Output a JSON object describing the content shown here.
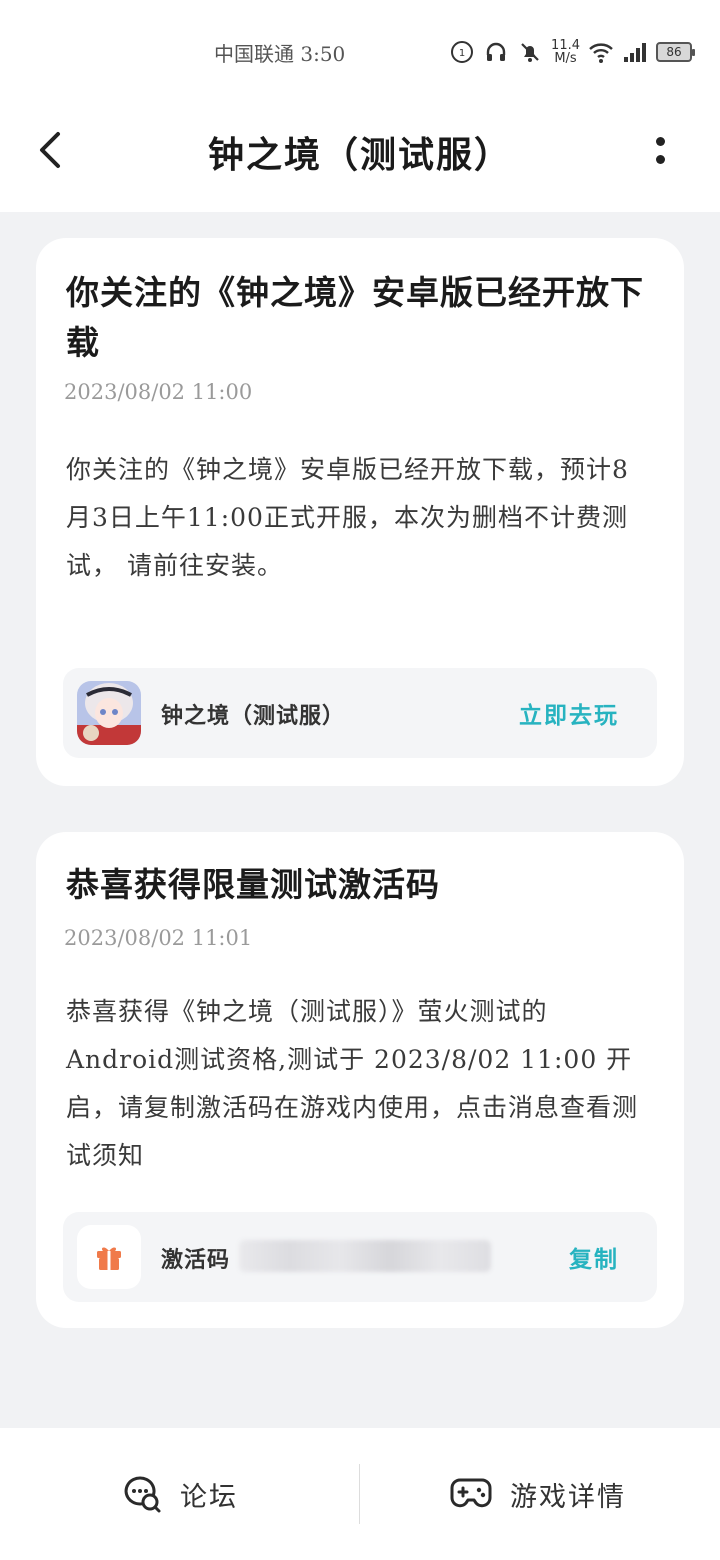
{
  "status_bar": {
    "carrier_time": "中国联通 3:50",
    "net_speed_value": "11.4",
    "net_speed_unit": "M/s",
    "battery": "86"
  },
  "header": {
    "title": "钟之境（测试服）"
  },
  "messages": [
    {
      "title": "你关注的《钟之境》安卓版已经开放下载",
      "date": "2023/08/02 11:00",
      "body": "你关注的《钟之境》安卓版已经开放下载，预计8月3日上午11:00正式开服，本次为删档不计费测试， 请前往安装。",
      "game_name": "钟之境（测试服）",
      "action_label": "立即去玩"
    },
    {
      "title": "恭喜获得限量测试激活码",
      "date": "2023/08/02 11:01",
      "body": "恭喜获得《钟之境（测试服）》萤火测试的Android测试资格,测试于 2023/8/02 11:00 开启，请复制激活码在游戏内使用，点击消息查看测试须知",
      "code_label": "激活码",
      "action_label": "复制"
    }
  ],
  "bottom_bar": {
    "forum_label": "论坛",
    "game_detail_label": "游戏详情"
  },
  "colors": {
    "accent": "#27b3c0",
    "gift": "#f07a4a",
    "background": "#f1f2f4"
  }
}
